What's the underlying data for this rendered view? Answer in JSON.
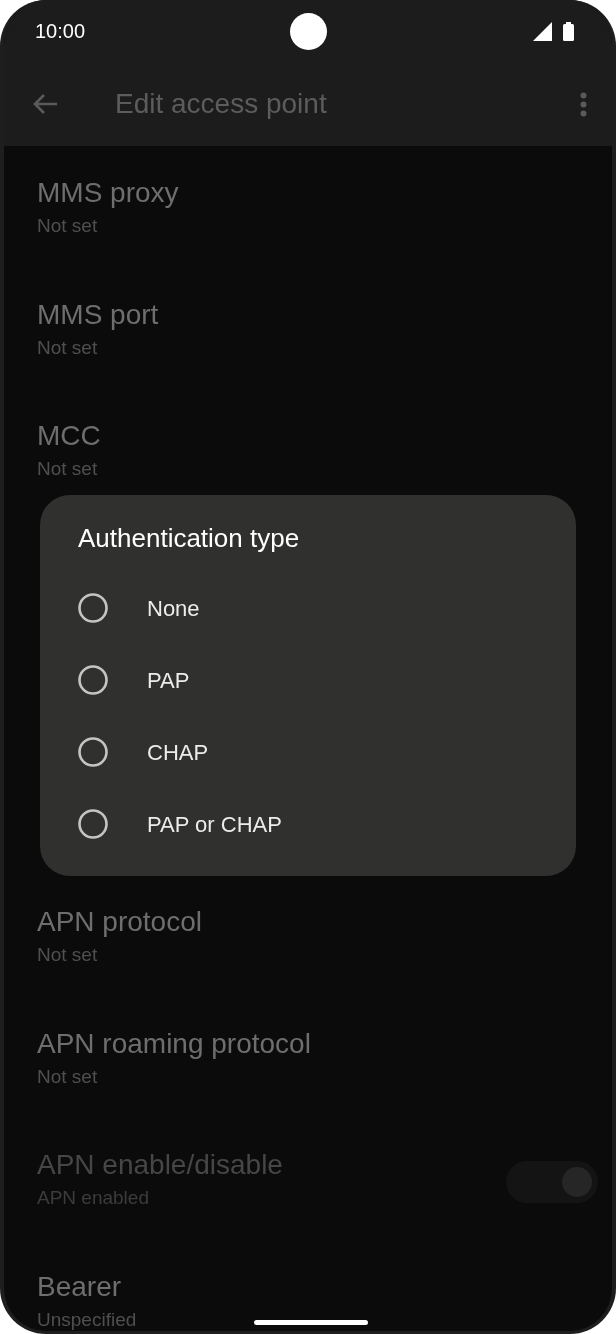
{
  "status_bar": {
    "time": "10:00"
  },
  "app_bar": {
    "title": "Edit access point"
  },
  "settings_top": [
    {
      "kind": "text",
      "title": "MMS proxy",
      "summary": "Not set",
      "disabled": false
    },
    {
      "kind": "text",
      "title": "MMS port",
      "summary": "Not set",
      "disabled": false
    },
    {
      "kind": "text",
      "title": "MCC",
      "summary": "Not set",
      "disabled": false
    }
  ],
  "settings_bottom": [
    {
      "kind": "text",
      "title": "APN protocol",
      "summary": "Not set",
      "disabled": false
    },
    {
      "kind": "text",
      "title": "APN roaming protocol",
      "summary": "Not set",
      "disabled": false
    },
    {
      "kind": "switch",
      "title": "APN enable/disable",
      "summary": "APN enabled",
      "disabled": true,
      "on": true
    },
    {
      "kind": "text",
      "title": "Bearer",
      "summary": "Unspecified",
      "disabled": false
    }
  ],
  "dialog": {
    "title": "Authentication type",
    "options": [
      {
        "label": "None",
        "selected": false
      },
      {
        "label": "PAP",
        "selected": false
      },
      {
        "label": "CHAP",
        "selected": false
      },
      {
        "label": "PAP or CHAP",
        "selected": false
      }
    ]
  }
}
